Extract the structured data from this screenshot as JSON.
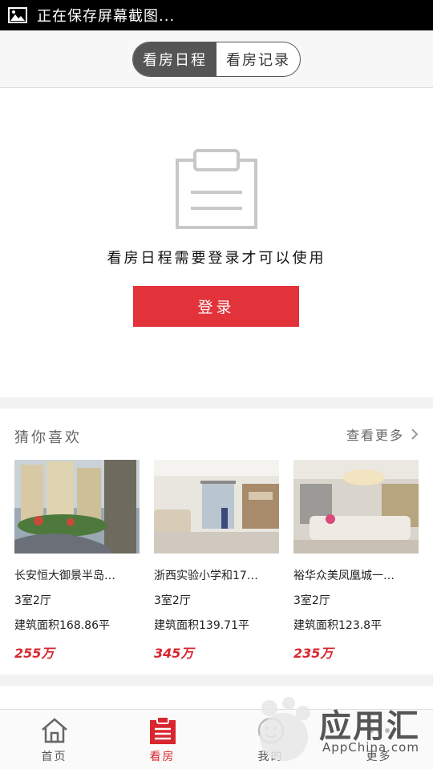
{
  "status_bar": {
    "text": "正在保存屏幕截图..."
  },
  "segmented_tabs": [
    {
      "label": "看房日程",
      "active": true
    },
    {
      "label": "看房记录",
      "active": false
    }
  ],
  "login_prompt": {
    "message": "看房日程需要登录才可以使用",
    "button_label": "登录"
  },
  "guess": {
    "title": "猜你喜欢",
    "more_label": "查看更多",
    "listings": [
      {
        "name": "长安恒大御景半岛…",
        "rooms": "3室2厅",
        "area": "建筑面积168.86平",
        "price": "255万"
      },
      {
        "name": "浙西实验小学和17…",
        "rooms": "3室2厅",
        "area": "建筑面积139.71平",
        "price": "345万"
      },
      {
        "name": "裕华众美凤凰城一…",
        "rooms": "3室2厅",
        "area": "建筑面积123.8平",
        "price": "235万"
      }
    ]
  },
  "tab_bar": [
    {
      "label": "首页",
      "icon": "home-icon",
      "active": false
    },
    {
      "label": "看房",
      "icon": "schedule-icon",
      "active": true
    },
    {
      "label": "我的",
      "icon": "profile-icon",
      "active": false
    },
    {
      "label": "更多",
      "icon": "more-icon",
      "active": false
    }
  ],
  "watermark": {
    "title": "应用汇",
    "subtitle": "AppChina.com"
  },
  "colors": {
    "accent": "#e2323a",
    "price": "#d9262e",
    "segment_active": "#555555"
  }
}
